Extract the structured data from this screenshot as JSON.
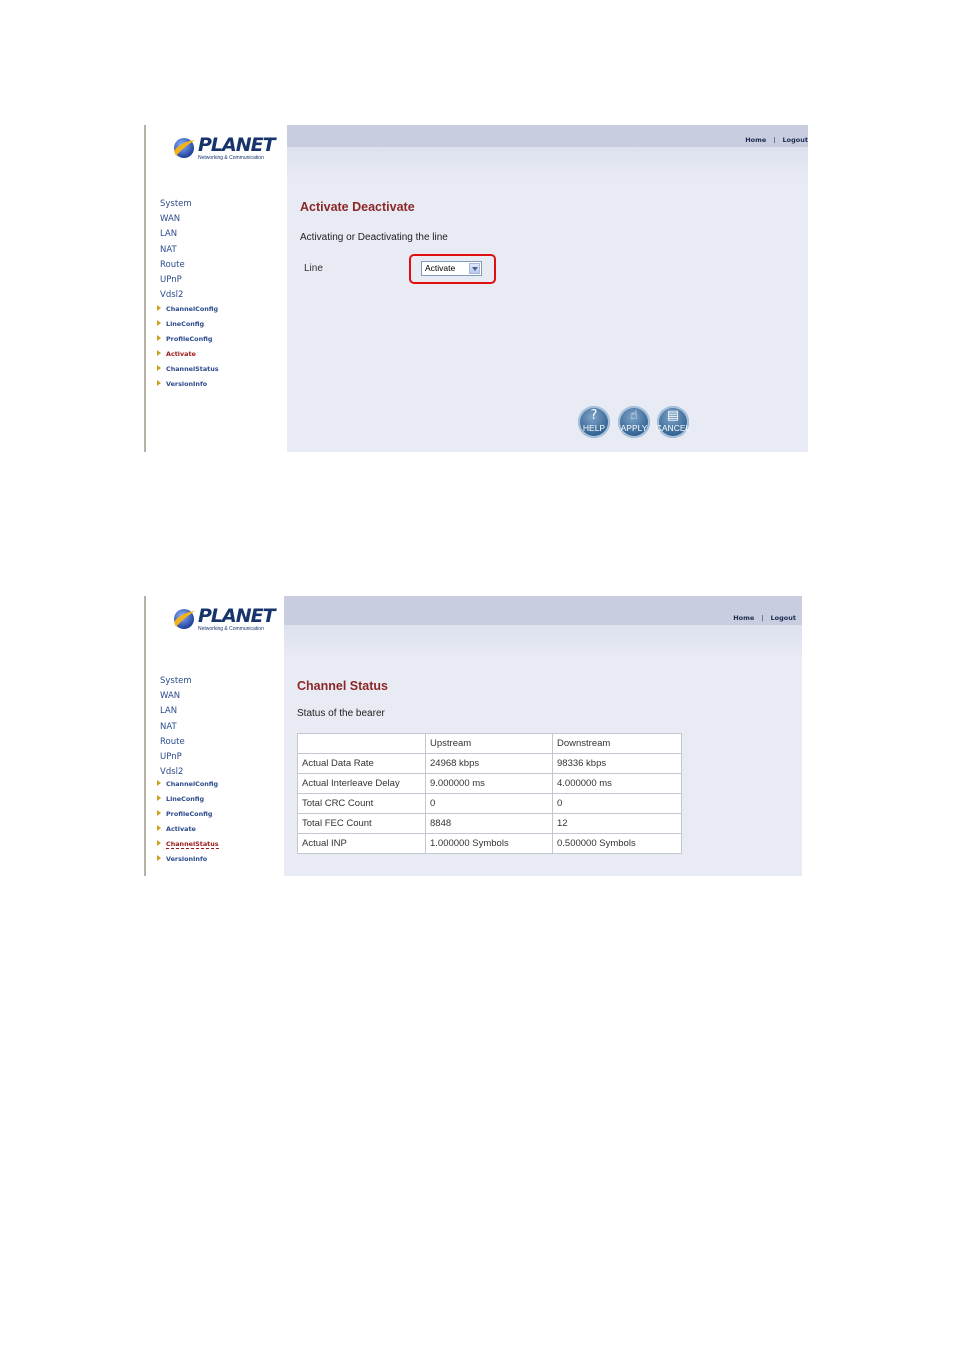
{
  "brand": {
    "name": "PLANET",
    "tagline": "Networking & Communication"
  },
  "top_links": {
    "home": "Home",
    "separator": "|",
    "logout": "Logout"
  },
  "menu": [
    "System",
    "WAN",
    "LAN",
    "NAT",
    "Route",
    "UPnP",
    "Vdsl2"
  ],
  "submenu": [
    "ChannelConfig",
    "LineConfig",
    "ProfileConfig",
    "Activate",
    "ChannelStatus",
    "VersionInfo"
  ],
  "activate_page": {
    "active_item": "Activate",
    "title": "Activate Deactivate",
    "description": "Activating or Deactivating the line",
    "line_label": "Line",
    "line_value": "Activate",
    "buttons": {
      "help": "HELP",
      "apply": "APPLY",
      "cancel": "CANCEL"
    }
  },
  "status_page": {
    "active_item": "ChannelStatus",
    "title": "Channel Status",
    "description": "Status of the bearer",
    "columns": [
      "",
      "Upstream",
      "Downstream"
    ],
    "rows": [
      [
        "Actual Data Rate",
        "24968 kbps",
        "98336 kbps"
      ],
      [
        "Actual Interleave Delay",
        "9.000000 ms",
        "4.000000 ms"
      ],
      [
        "Total CRC Count",
        "0",
        "0"
      ],
      [
        "Total FEC Count",
        "8848",
        "12"
      ],
      [
        "Actual INP",
        "1.000000 Symbols",
        "0.500000 Symbols"
      ]
    ]
  },
  "colors": {
    "accent": "#8b2727",
    "link": "#2c4a8c",
    "highlight": "#e01010",
    "panel": "#e9ebf4"
  }
}
